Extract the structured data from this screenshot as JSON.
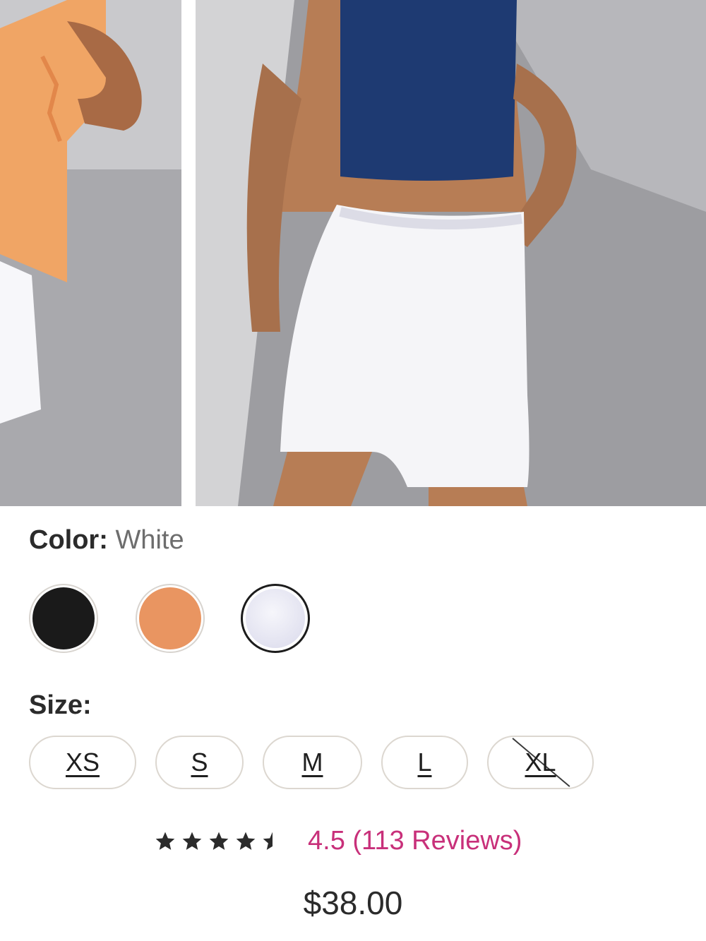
{
  "gallery": {
    "images": [
      {
        "name": "product-photo-orange-top"
      },
      {
        "name": "product-photo-white-shorts"
      }
    ]
  },
  "color": {
    "label": "Color:",
    "selected": "White",
    "swatches": [
      {
        "name": "Black",
        "hex": "#1a1a1a",
        "selected": false
      },
      {
        "name": "Orange",
        "hex": "#e99561",
        "selected": false
      },
      {
        "name": "White",
        "hex": "#e9e9f5",
        "selected": true
      }
    ]
  },
  "size": {
    "label": "Size:",
    "options": [
      {
        "label": "XS",
        "available": true
      },
      {
        "label": "S",
        "available": true
      },
      {
        "label": "M",
        "available": true
      },
      {
        "label": "L",
        "available": true
      },
      {
        "label": "XL",
        "available": false
      }
    ]
  },
  "rating": {
    "score": 4.5,
    "max": 5,
    "text": "4.5 (113 Reviews)",
    "color": "#c8307a"
  },
  "price": "$38.00"
}
